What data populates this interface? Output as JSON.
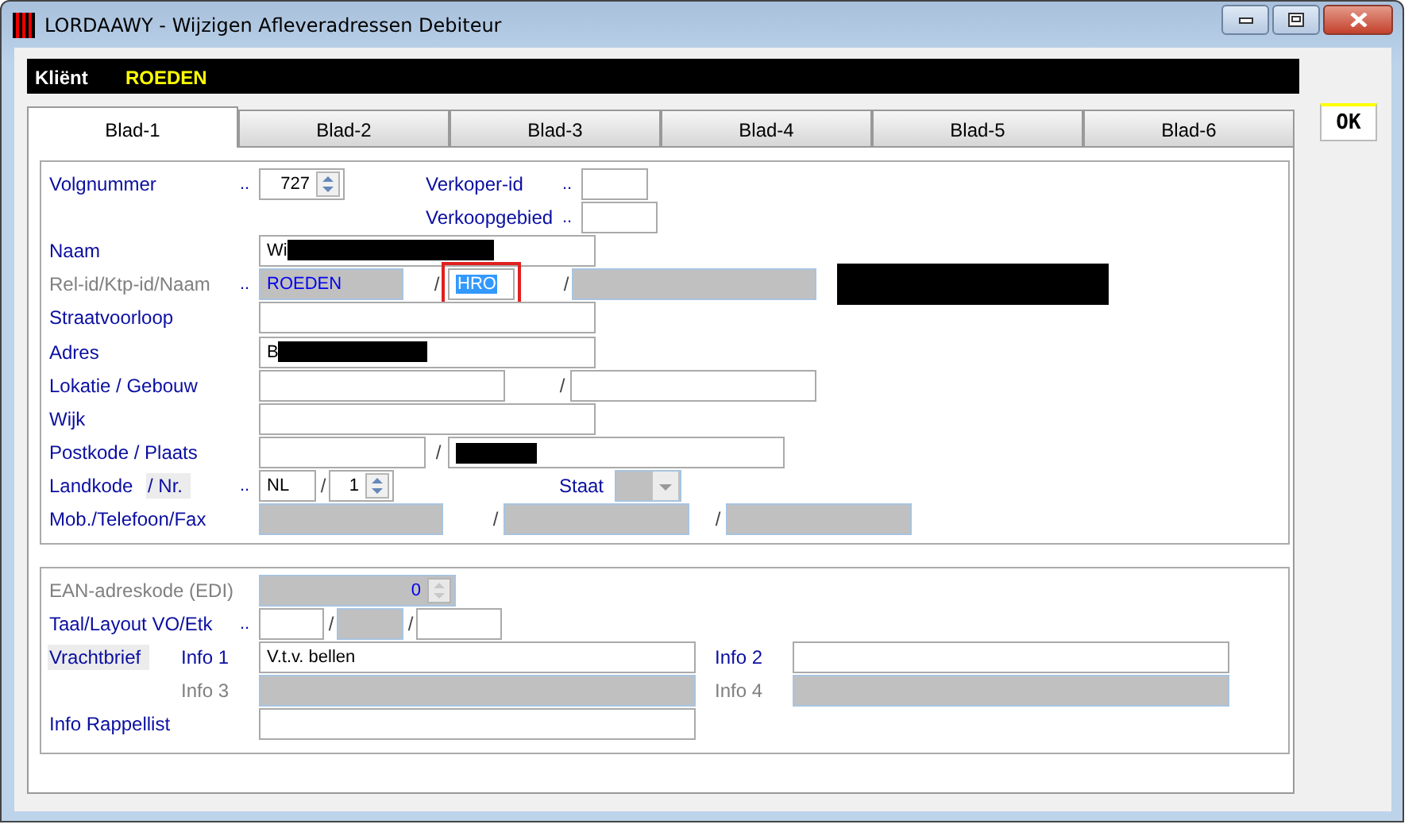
{
  "window": {
    "title": "LORDAAWY - Wijzigen Afleveradressen Debiteur"
  },
  "header": {
    "label": "Kliënt",
    "value": "ROEDEN"
  },
  "tabs": [
    {
      "label": "Blad-1",
      "selected": true
    },
    {
      "label": "Blad-2",
      "selected": false
    },
    {
      "label": "Blad-3",
      "selected": false
    },
    {
      "label": "Blad-4",
      "selected": false
    },
    {
      "label": "Blad-5",
      "selected": false
    },
    {
      "label": "Blad-6",
      "selected": false
    }
  ],
  "ok_button": "OK",
  "sections": [
    {
      "rows": [
        {
          "items": [
            {
              "kind": "label",
              "text": "Volgnummer",
              "disabled": false
            },
            {
              "kind": "dots",
              "text": ".."
            },
            {
              "kind": "spinner",
              "value": "727",
              "disabled": false
            },
            {
              "kind": "label",
              "text": "Verkoper-id",
              "disabled": false
            },
            {
              "kind": "dots",
              "text": ".."
            },
            {
              "kind": "field",
              "disabled": false,
              "focused": false
            }
          ]
        },
        {
          "items": [
            {
              "kind": "label",
              "text": "Verkoopgebied",
              "disabled": false
            },
            {
              "kind": "dots",
              "text": ".."
            },
            {
              "kind": "field",
              "disabled": false,
              "focused": false
            }
          ]
        },
        {
          "items": [
            {
              "kind": "label",
              "text": "Naam",
              "disabled": false
            },
            {
              "kind": "field",
              "value": "Wi",
              "disabled": false,
              "focused": false,
              "redacted": true
            }
          ]
        },
        {
          "items": [
            {
              "kind": "label",
              "text": "Rel-id/Ktp-id/Naam",
              "disabled": true
            },
            {
              "kind": "dots",
              "text": ".."
            },
            {
              "kind": "field",
              "value": "ROEDEN",
              "disabled": true,
              "focused": false
            },
            {
              "kind": "slash",
              "text": "/"
            },
            {
              "kind": "field",
              "value": "HRO",
              "disabled": false,
              "focused": true
            },
            {
              "kind": "slash",
              "text": "/"
            },
            {
              "kind": "field",
              "disabled": true,
              "focused": false
            },
            {
              "kind": "redaction"
            }
          ]
        },
        {
          "items": [
            {
              "kind": "label",
              "text": "Straatvoorloop",
              "disabled": false
            },
            {
              "kind": "field",
              "disabled": false,
              "focused": false
            }
          ]
        },
        {
          "items": [
            {
              "kind": "label",
              "text": "Adres",
              "disabled": false
            },
            {
              "kind": "field",
              "value": "B",
              "disabled": false,
              "focused": false,
              "redacted": true
            }
          ]
        },
        {
          "items": [
            {
              "kind": "label",
              "text": "Lokatie / Gebouw",
              "disabled": false
            },
            {
              "kind": "field",
              "disabled": false,
              "focused": false
            },
            {
              "kind": "slash",
              "text": "/"
            },
            {
              "kind": "field",
              "disabled": false,
              "focused": false
            }
          ]
        },
        {
          "items": [
            {
              "kind": "label",
              "text": "Wijk",
              "disabled": false
            },
            {
              "kind": "field",
              "disabled": false,
              "focused": false
            }
          ]
        },
        {
          "items": [
            {
              "kind": "label",
              "text": "Postkode / Plaats",
              "disabled": false
            },
            {
              "kind": "field",
              "disabled": false,
              "focused": false
            },
            {
              "kind": "slash",
              "text": "/"
            },
            {
              "kind": "field",
              "disabled": false,
              "focused": false,
              "redacted": true
            }
          ]
        },
        {
          "items": [
            {
              "kind": "label",
              "text": "Landkode",
              "disabled": false
            },
            {
              "kind": "link",
              "text": "/ Nr."
            },
            {
              "kind": "dots",
              "text": ".."
            },
            {
              "kind": "field",
              "value": "NL",
              "disabled": false,
              "focused": false
            },
            {
              "kind": "slash",
              "text": "/"
            },
            {
              "kind": "spinner",
              "value": "1",
              "disabled": false
            },
            {
              "kind": "label",
              "text": "Staat",
              "disabled": false
            },
            {
              "kind": "combo",
              "disabled": true
            }
          ]
        },
        {
          "items": [
            {
              "kind": "label",
              "text": "Mob./Telefoon/Fax",
              "disabled": false
            },
            {
              "kind": "field",
              "disabled": true,
              "focused": false
            },
            {
              "kind": "slash",
              "text": "/"
            },
            {
              "kind": "field",
              "disabled": true,
              "focused": false
            },
            {
              "kind": "slash",
              "text": "/"
            },
            {
              "kind": "field",
              "disabled": true,
              "focused": false
            }
          ]
        }
      ]
    },
    {
      "rows": [
        {
          "items": [
            {
              "kind": "label",
              "text": "EAN-adreskode (EDI)",
              "disabled": true
            },
            {
              "kind": "spinner",
              "value": "0",
              "disabled": true
            }
          ]
        },
        {
          "items": [
            {
              "kind": "label",
              "text": "Taal/Layout VO/Etk",
              "disabled": false
            },
            {
              "kind": "dots",
              "text": ".."
            },
            {
              "kind": "field",
              "disabled": false,
              "focused": false
            },
            {
              "kind": "slash",
              "text": "/"
            },
            {
              "kind": "field",
              "disabled": true,
              "focused": false
            },
            {
              "kind": "slash",
              "text": "/"
            },
            {
              "kind": "field",
              "disabled": false,
              "focused": false
            }
          ]
        },
        {
          "items": [
            {
              "kind": "link",
              "text": "Vrachtbrief"
            },
            {
              "kind": "label",
              "text": "Info 1",
              "disabled": false
            },
            {
              "kind": "field",
              "value": "V.t.v. bellen",
              "disabled": false,
              "focused": false
            },
            {
              "kind": "label",
              "text": "Info 2",
              "disabled": false
            },
            {
              "kind": "field",
              "disabled": false,
              "focused": false
            }
          ]
        },
        {
          "items": [
            {
              "kind": "label",
              "text": "Info 3",
              "disabled": true
            },
            {
              "kind": "field",
              "disabled": true,
              "focused": false
            },
            {
              "kind": "label",
              "text": "Info 4",
              "disabled": true
            },
            {
              "kind": "field",
              "disabled": true,
              "focused": false
            }
          ]
        },
        {
          "items": [
            {
              "kind": "label",
              "text": "Info Rappellist",
              "disabled": false
            },
            {
              "kind": "field",
              "disabled": false,
              "focused": false
            }
          ]
        }
      ]
    }
  ]
}
